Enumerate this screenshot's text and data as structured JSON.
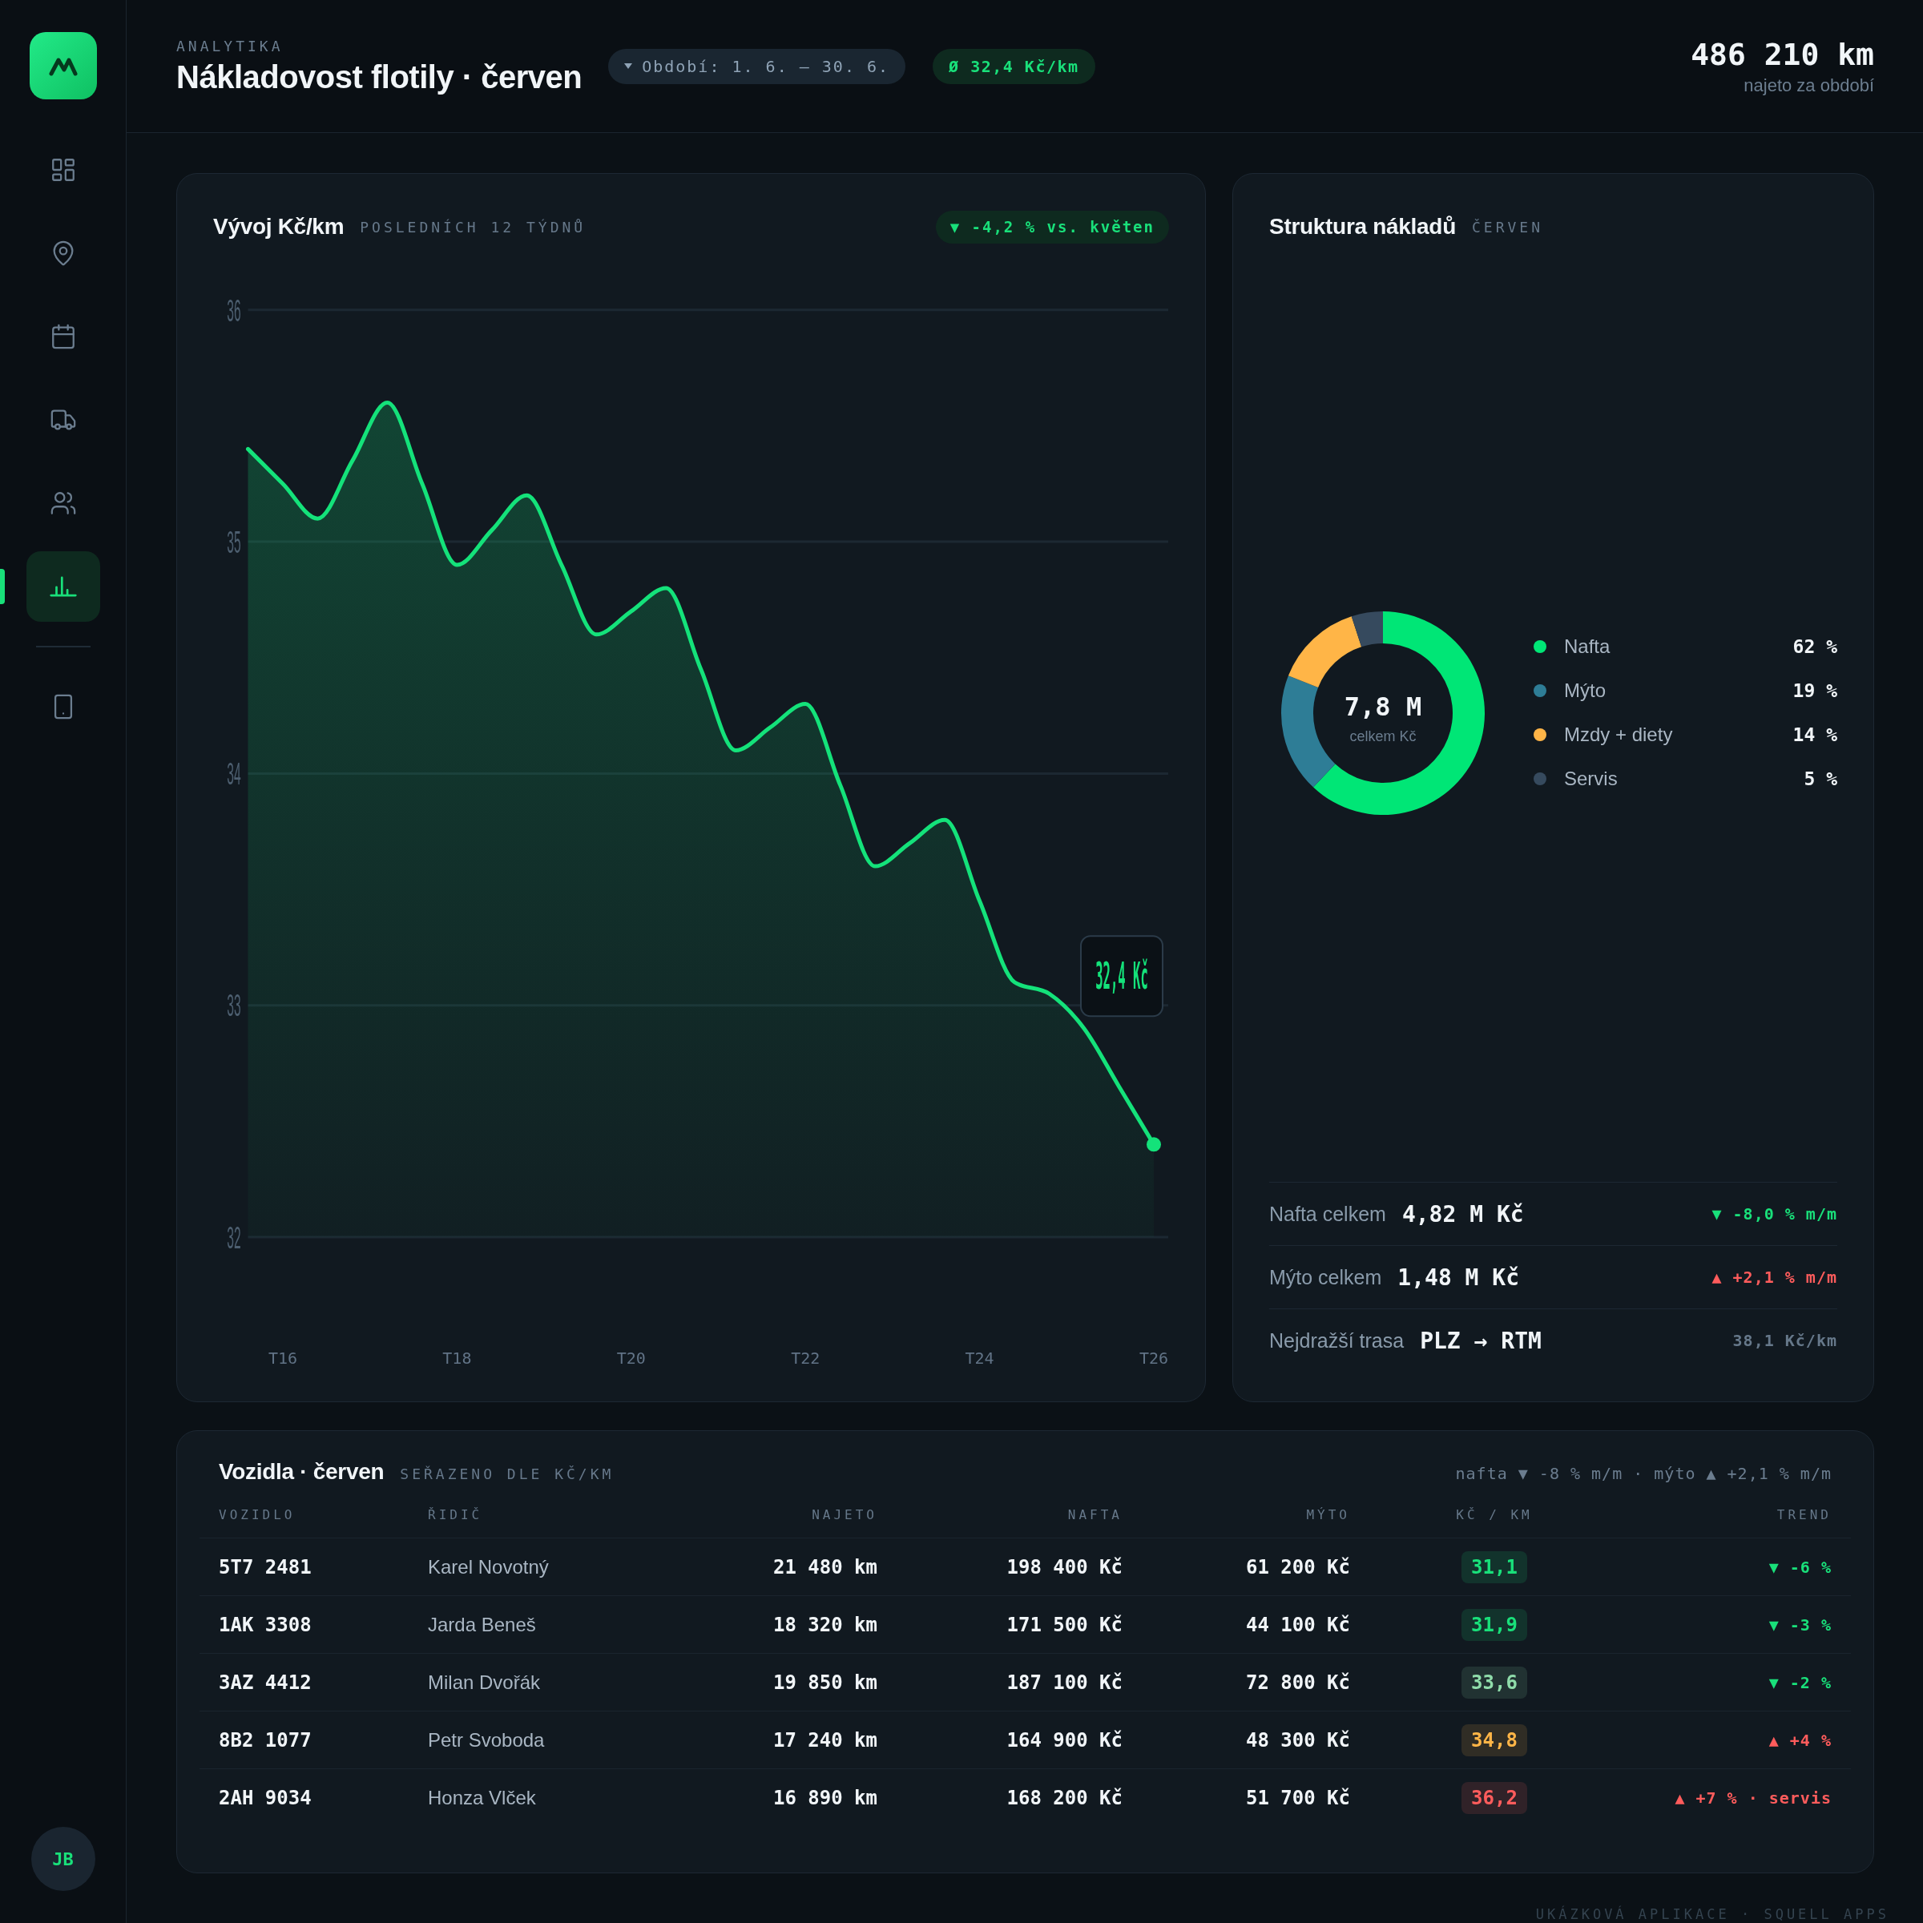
{
  "sidebar": {
    "nav_items": [
      {
        "selected": false
      },
      {
        "selected": false
      },
      {
        "selected": false
      },
      {
        "selected": false
      },
      {
        "selected": false
      },
      {
        "selected": true
      }
    ],
    "secondary_items": [
      {
        "selected": false
      }
    ],
    "avatar": "JB"
  },
  "header": {
    "eyebrow": "ANALYTIKA",
    "title": "Nákladovost flotily · červen",
    "period": "Období: 1. 6. – 30. 6.",
    "average": "Ø 32,4 Kč/km",
    "total": "486 210 km",
    "total_caption": "najeto za období"
  },
  "trend_card": {
    "title": "Vývoj Kč/km",
    "subtitle": "POSLEDNÍCH 12 TÝDNŮ",
    "badge": "▼ -4,2 % vs. květen",
    "chart_data": {
      "type": "area",
      "categories": [
        null,
        "T16",
        null,
        null,
        null,
        null,
        "T18",
        null,
        null,
        null,
        null,
        "T20",
        null,
        null,
        null,
        null,
        "T22",
        null,
        null,
        null,
        null,
        "T24",
        null,
        null,
        null,
        null,
        "T26"
      ],
      "values": [
        35.4,
        35.25,
        35.1,
        35.35,
        35.6,
        35.25,
        34.9,
        35.05,
        35.2,
        34.9,
        34.6,
        34.7,
        34.8,
        34.45,
        34.1,
        34.2,
        34.3,
        33.95,
        33.6,
        33.7,
        33.8,
        33.45,
        33.1,
        33.05,
        32.9,
        32.65,
        32.4
      ],
      "ylim": [
        32,
        36
      ],
      "yticks": [
        32,
        33,
        34,
        35,
        36
      ],
      "grid": true,
      "annotations": [
        "32,4 Kč"
      ]
    }
  },
  "cost_card": {
    "title": "Struktura nákladů",
    "subtitle": "ČERVEN",
    "center_value": "7,8 M",
    "center_caption": "celkem Kč",
    "chart_data": {
      "type": "donut",
      "categories": [
        "Nafta",
        "Mýto",
        "Mzdy + diety",
        "Servis"
      ],
      "values": [
        62,
        19,
        14,
        5
      ],
      "value_labels": [
        "62 %",
        "19 %",
        "14 %",
        "5 %"
      ],
      "colors": [
        "#00e676",
        "#2e7d96",
        "#ffb547",
        "#364a5e"
      ]
    },
    "stats": [
      {
        "label": "Nafta celkem",
        "value": "4,82 M Kč",
        "change": "▼ -8,0 % m/m",
        "color": "#19e07a"
      },
      {
        "label": "Mýto celkem",
        "value": "1,48 M Kč",
        "change": "▲ +2,1 % m/m",
        "color": "#ff5c5c"
      },
      {
        "label": "Nejdražší trasa",
        "value": "PLZ → RTM",
        "change": "38,1 Kč/km",
        "color": "#66788a"
      }
    ]
  },
  "vehicles": {
    "title": "Vozidla · červen",
    "subtitle": "SEŘAZENO DLE KČ/KM",
    "summary": "nafta ▼ -8 % m/m · mýto ▲ +2,1 % m/m",
    "columns": [
      "VOZIDLO",
      "ŘIDIČ",
      "NAJETO",
      "NAFTA",
      "MÝTO",
      "KČ / KM",
      "TREND"
    ],
    "rows": [
      {
        "vehicle": "5T7 2481",
        "driver": "Karel Novotný",
        "distance": "21 480 km",
        "fuel": "198 400 Kč",
        "toll": "61 200 Kč",
        "cost_per_km": {
          "text": "31,1",
          "color": "#19e07a"
        },
        "trend": {
          "text": "▼ -6 %",
          "color": "#19e07a"
        }
      },
      {
        "vehicle": "1AK 3308",
        "driver": "Jarda Beneš",
        "distance": "18 320 km",
        "fuel": "171 500 Kč",
        "toll": "44 100 Kč",
        "cost_per_km": {
          "text": "31,9",
          "color": "#19e07a"
        },
        "trend": {
          "text": "▼ -3 %",
          "color": "#19e07a"
        }
      },
      {
        "vehicle": "3AZ 4412",
        "driver": "Milan Dvořák",
        "distance": "19 850 km",
        "fuel": "187 100 Kč",
        "toll": "72 800 Kč",
        "cost_per_km": {
          "text": "33,6",
          "color": "#8fdcaa"
        },
        "trend": {
          "text": "▼ -2 %",
          "color": "#19e07a"
        }
      },
      {
        "vehicle": "8B2 1077",
        "driver": "Petr Svoboda",
        "distance": "17 240 km",
        "fuel": "164 900 Kč",
        "toll": "48 300 Kč",
        "cost_per_km": {
          "text": "34,8",
          "color": "#ffb547"
        },
        "trend": {
          "text": "▲ +4 %",
          "color": "#ff5c5c"
        }
      },
      {
        "vehicle": "2AH 9034",
        "driver": "Honza Vlček",
        "distance": "16 890 km",
        "fuel": "168 200 Kč",
        "toll": "51 700 Kč",
        "cost_per_km": {
          "text": "36,2",
          "color": "#ff5c5c"
        },
        "trend": {
          "text": "▲ +7 % · servis",
          "color": "#ff5c5c"
        }
      }
    ]
  },
  "footer": "UKÁZKOVÁ APLIKACE · SQUELL APPS"
}
